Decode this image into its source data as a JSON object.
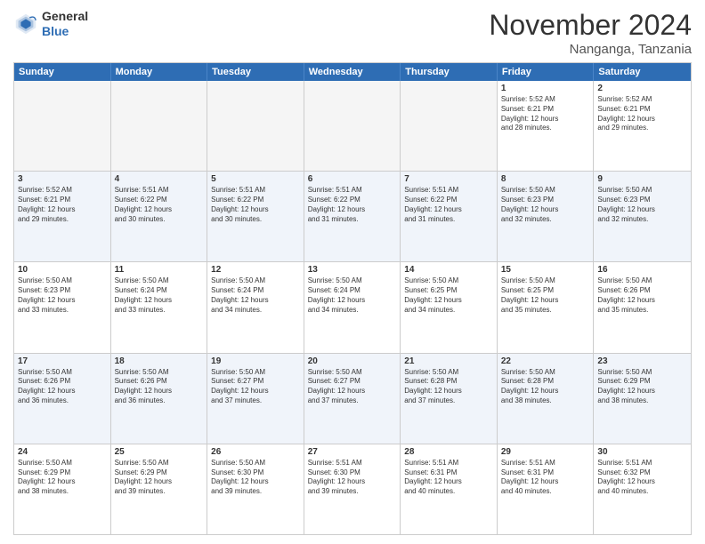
{
  "header": {
    "logo_line1": "General",
    "logo_line2": "Blue",
    "month": "November 2024",
    "location": "Nanganga, Tanzania"
  },
  "weekdays": [
    "Sunday",
    "Monday",
    "Tuesday",
    "Wednesday",
    "Thursday",
    "Friday",
    "Saturday"
  ],
  "rows": [
    {
      "alt": false,
      "cells": [
        {
          "day": "",
          "info": ""
        },
        {
          "day": "",
          "info": ""
        },
        {
          "day": "",
          "info": ""
        },
        {
          "day": "",
          "info": ""
        },
        {
          "day": "",
          "info": ""
        },
        {
          "day": "1",
          "info": "Sunrise: 5:52 AM\nSunset: 6:21 PM\nDaylight: 12 hours\nand 28 minutes."
        },
        {
          "day": "2",
          "info": "Sunrise: 5:52 AM\nSunset: 6:21 PM\nDaylight: 12 hours\nand 29 minutes."
        }
      ]
    },
    {
      "alt": true,
      "cells": [
        {
          "day": "3",
          "info": "Sunrise: 5:52 AM\nSunset: 6:21 PM\nDaylight: 12 hours\nand 29 minutes."
        },
        {
          "day": "4",
          "info": "Sunrise: 5:51 AM\nSunset: 6:22 PM\nDaylight: 12 hours\nand 30 minutes."
        },
        {
          "day": "5",
          "info": "Sunrise: 5:51 AM\nSunset: 6:22 PM\nDaylight: 12 hours\nand 30 minutes."
        },
        {
          "day": "6",
          "info": "Sunrise: 5:51 AM\nSunset: 6:22 PM\nDaylight: 12 hours\nand 31 minutes."
        },
        {
          "day": "7",
          "info": "Sunrise: 5:51 AM\nSunset: 6:22 PM\nDaylight: 12 hours\nand 31 minutes."
        },
        {
          "day": "8",
          "info": "Sunrise: 5:50 AM\nSunset: 6:23 PM\nDaylight: 12 hours\nand 32 minutes."
        },
        {
          "day": "9",
          "info": "Sunrise: 5:50 AM\nSunset: 6:23 PM\nDaylight: 12 hours\nand 32 minutes."
        }
      ]
    },
    {
      "alt": false,
      "cells": [
        {
          "day": "10",
          "info": "Sunrise: 5:50 AM\nSunset: 6:23 PM\nDaylight: 12 hours\nand 33 minutes."
        },
        {
          "day": "11",
          "info": "Sunrise: 5:50 AM\nSunset: 6:24 PM\nDaylight: 12 hours\nand 33 minutes."
        },
        {
          "day": "12",
          "info": "Sunrise: 5:50 AM\nSunset: 6:24 PM\nDaylight: 12 hours\nand 34 minutes."
        },
        {
          "day": "13",
          "info": "Sunrise: 5:50 AM\nSunset: 6:24 PM\nDaylight: 12 hours\nand 34 minutes."
        },
        {
          "day": "14",
          "info": "Sunrise: 5:50 AM\nSunset: 6:25 PM\nDaylight: 12 hours\nand 34 minutes."
        },
        {
          "day": "15",
          "info": "Sunrise: 5:50 AM\nSunset: 6:25 PM\nDaylight: 12 hours\nand 35 minutes."
        },
        {
          "day": "16",
          "info": "Sunrise: 5:50 AM\nSunset: 6:26 PM\nDaylight: 12 hours\nand 35 minutes."
        }
      ]
    },
    {
      "alt": true,
      "cells": [
        {
          "day": "17",
          "info": "Sunrise: 5:50 AM\nSunset: 6:26 PM\nDaylight: 12 hours\nand 36 minutes."
        },
        {
          "day": "18",
          "info": "Sunrise: 5:50 AM\nSunset: 6:26 PM\nDaylight: 12 hours\nand 36 minutes."
        },
        {
          "day": "19",
          "info": "Sunrise: 5:50 AM\nSunset: 6:27 PM\nDaylight: 12 hours\nand 37 minutes."
        },
        {
          "day": "20",
          "info": "Sunrise: 5:50 AM\nSunset: 6:27 PM\nDaylight: 12 hours\nand 37 minutes."
        },
        {
          "day": "21",
          "info": "Sunrise: 5:50 AM\nSunset: 6:28 PM\nDaylight: 12 hours\nand 37 minutes."
        },
        {
          "day": "22",
          "info": "Sunrise: 5:50 AM\nSunset: 6:28 PM\nDaylight: 12 hours\nand 38 minutes."
        },
        {
          "day": "23",
          "info": "Sunrise: 5:50 AM\nSunset: 6:29 PM\nDaylight: 12 hours\nand 38 minutes."
        }
      ]
    },
    {
      "alt": false,
      "cells": [
        {
          "day": "24",
          "info": "Sunrise: 5:50 AM\nSunset: 6:29 PM\nDaylight: 12 hours\nand 38 minutes."
        },
        {
          "day": "25",
          "info": "Sunrise: 5:50 AM\nSunset: 6:29 PM\nDaylight: 12 hours\nand 39 minutes."
        },
        {
          "day": "26",
          "info": "Sunrise: 5:50 AM\nSunset: 6:30 PM\nDaylight: 12 hours\nand 39 minutes."
        },
        {
          "day": "27",
          "info": "Sunrise: 5:51 AM\nSunset: 6:30 PM\nDaylight: 12 hours\nand 39 minutes."
        },
        {
          "day": "28",
          "info": "Sunrise: 5:51 AM\nSunset: 6:31 PM\nDaylight: 12 hours\nand 40 minutes."
        },
        {
          "day": "29",
          "info": "Sunrise: 5:51 AM\nSunset: 6:31 PM\nDaylight: 12 hours\nand 40 minutes."
        },
        {
          "day": "30",
          "info": "Sunrise: 5:51 AM\nSunset: 6:32 PM\nDaylight: 12 hours\nand 40 minutes."
        }
      ]
    }
  ]
}
